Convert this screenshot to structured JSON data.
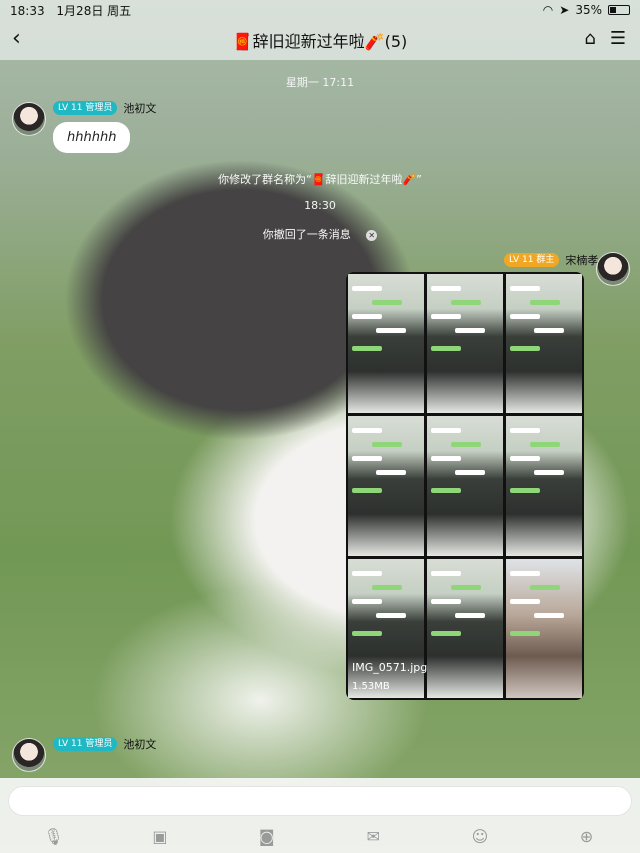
{
  "status_bar": {
    "time": "18:33",
    "date": "1月28日 周五",
    "battery": "35%",
    "battery_level": 0.35
  },
  "nav": {
    "back_icon": "chevron-left-icon",
    "title": "🧧辞旧迎新过年啦🧨(5)"
  },
  "messages": {
    "time_1": "星期一 17:11",
    "sender_1": {
      "badge": "LV 11 管理员",
      "name": "池初文",
      "text": "hhhhhh"
    },
    "rename_notice": "你修改了群名称为“🧧辞旧迎新过年啦🧨”",
    "time_2": "18:30",
    "recall_notice": "你撤回了一条消息",
    "sender_2": {
      "badge": "LV 11 群主",
      "name": "宋楠孝",
      "file_name": "IMG_0571.jpg",
      "file_size": "1.53MB"
    },
    "sender_3": {
      "badge": "LV 11 管理员",
      "name": "池初文"
    }
  },
  "toolbar": {
    "icons": [
      "microphone-icon",
      "image-icon",
      "camera-icon",
      "red-packet-icon",
      "emoji-icon",
      "plus-icon"
    ]
  },
  "colors": {
    "admin_badge": "#1fb8c3",
    "owner_badge": "#f0a824"
  }
}
